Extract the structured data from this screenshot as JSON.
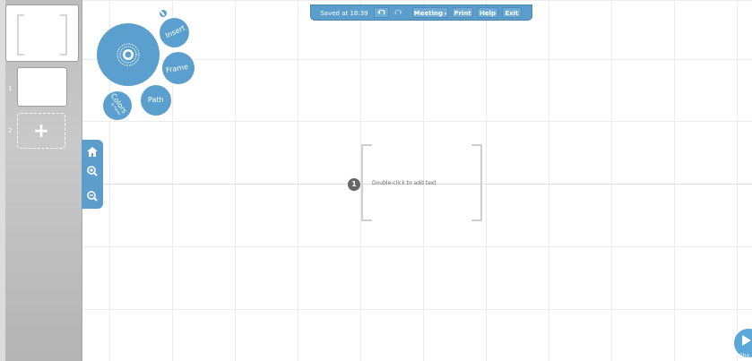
{
  "toolbar": {
    "saved_status": "Saved at 18:39",
    "undo_icon": "undo-arrow-icon",
    "redo_icon": "redo-arrow-icon",
    "meeting_label": "Meeting",
    "print_label": "Print",
    "help_label": "Help",
    "exit_label": "Exit"
  },
  "bubble_menu": {
    "center_icon": "zebra-target-icon",
    "insert_label": "Insert",
    "frame_label": "Frame",
    "path_label": "Path",
    "colors_label": "Colors",
    "fonts_label": "& Fonts",
    "pin_icon": "pin-icon"
  },
  "zoom_controls": {
    "home_icon": "home-icon",
    "zoom_in_icon": "zoom-in-icon",
    "zoom_out_icon": "zoom-out-icon"
  },
  "sidebar": {
    "overview_thumb": "overview",
    "items": [
      {
        "number": "1"
      },
      {
        "number": "2",
        "add_label": "+"
      }
    ]
  },
  "canvas": {
    "frame_number": "1",
    "placeholder_text": "Double-click to add text"
  },
  "show": {
    "label": "Sho"
  },
  "colors": {
    "accent": "#5b9ecb",
    "sidebar": "#c2c2c2",
    "grid": "#ececec"
  }
}
